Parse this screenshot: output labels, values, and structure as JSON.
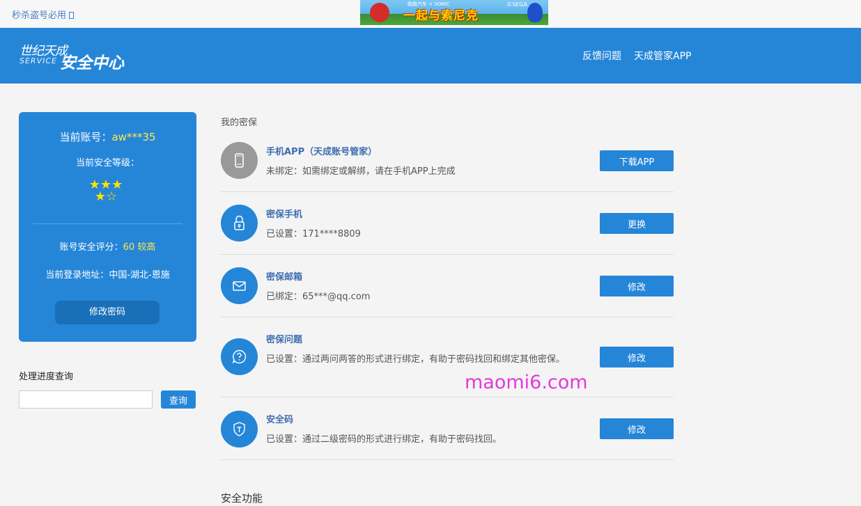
{
  "topbar": {
    "promo_text": "秒杀盗号必用",
    "banner": {
      "main_text": "一起与索尼克",
      "brand_text": "跑跑汽车 × SONIC",
      "sega_text": "©SEGA"
    }
  },
  "header": {
    "logo": {
      "line1": "世纪天成",
      "line2": "SERVICE",
      "line3": "安全中心"
    },
    "nav": [
      "反馈问题",
      "天成管家APP"
    ]
  },
  "account_card": {
    "account_label": "当前账号：",
    "account_value": "aw***35",
    "level_label": "当前安全等级：",
    "stars_filled": 4,
    "stars_total": 5,
    "score_label": "账号安全评分：",
    "score_value": "60 较高",
    "location_label": "当前登录地址：",
    "location_value": "中国-湖北-恩施",
    "change_password_label": "修改密码"
  },
  "progress": {
    "title": "处理进度查询",
    "input_value": "",
    "button_label": "查询"
  },
  "protection": {
    "title": "我的密保",
    "items": [
      {
        "icon": "phone-app-icon",
        "title": "手机APP（天成账号管家）",
        "desc": "未绑定：如需绑定或解绑，请在手机APP上完成",
        "button": "下载APP"
      },
      {
        "icon": "lock-icon",
        "title": "密保手机",
        "desc": "已设置：171****8809",
        "button": "更换"
      },
      {
        "icon": "mail-icon",
        "title": "密保邮箱",
        "desc": "已绑定：65***@qq.com",
        "button": "修改"
      },
      {
        "icon": "question-icon",
        "title": "密保问题",
        "desc": "已设置：通过两问两答的形式进行绑定，有助于密码找回和绑定其他密保。",
        "button": "修改"
      },
      {
        "icon": "shield-icon",
        "title": "安全码",
        "desc": "已设置：通过二级密码的形式进行绑定，有助于密码找回。",
        "button": "修改"
      }
    ]
  },
  "watermark": "maomi6.com",
  "section2_title": "安全功能",
  "colors": {
    "primary": "#2586d8",
    "accent_yellow": "#ffe84a",
    "watermark": "#e339d8"
  }
}
